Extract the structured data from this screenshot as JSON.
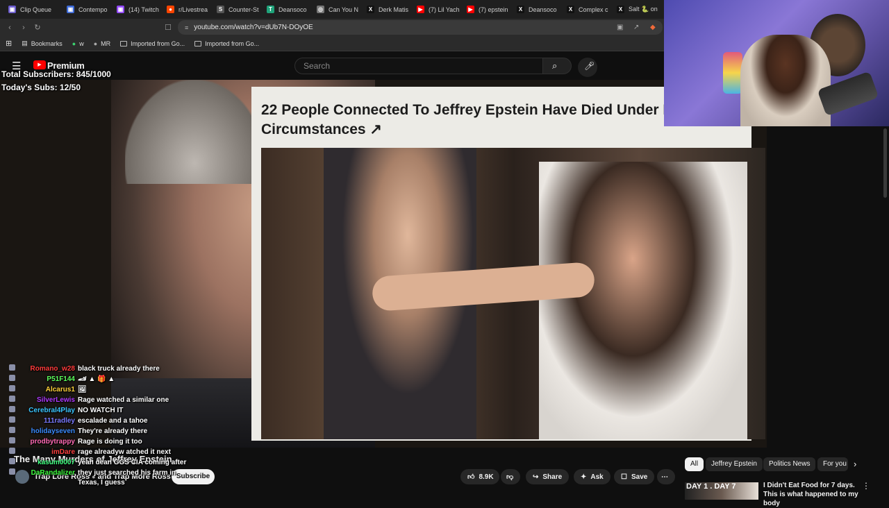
{
  "browser": {
    "tabs": [
      {
        "label": "Clip Queue",
        "color": "#6a5acd",
        "glyph": "▣"
      },
      {
        "label": "Contempo",
        "color": "#3c6ad9",
        "glyph": "▣"
      },
      {
        "label": "(14) Twitch",
        "color": "#9146ff",
        "glyph": "▣"
      },
      {
        "label": "r/Livestrea",
        "color": "#ff4500",
        "glyph": "●"
      },
      {
        "label": "Counter-St",
        "color": "#555555",
        "glyph": "S"
      },
      {
        "label": "Deansoco",
        "color": "#1fa37a",
        "glyph": "T"
      },
      {
        "label": "Can You N",
        "color": "#777777",
        "glyph": "◎"
      },
      {
        "label": "Derk Matis",
        "color": "#111111",
        "glyph": "X"
      },
      {
        "label": "(7) Lil Yach",
        "color": "#ff0000",
        "glyph": "▶"
      },
      {
        "label": "(7) epstein",
        "color": "#ff0000",
        "glyph": "▶"
      },
      {
        "label": "Deansoco",
        "color": "#111111",
        "glyph": "X"
      },
      {
        "label": "Complex c",
        "color": "#111111",
        "glyph": "X"
      },
      {
        "label": "Salt 🐍 on",
        "color": "#111111",
        "glyph": "X"
      },
      {
        "label": "",
        "color": "#ff0000",
        "glyph": "▶"
      }
    ],
    "url": "youtube.com/watch?v=dUb7N-DOyOE",
    "bookmarks": [
      {
        "label": "Bookmarks",
        "type": "bookmarks"
      },
      {
        "label": "w",
        "type": "site"
      },
      {
        "label": "MR",
        "type": "site"
      },
      {
        "label": "Imported from Go...",
        "type": "folder"
      },
      {
        "label": "Imported from Go...",
        "type": "folder"
      }
    ]
  },
  "youtube": {
    "logo_text": "Premium",
    "search_placeholder": "Search",
    "article_title": "22 People Connected To Jeffrey Epstein Have Died Under Mysterious Circumstances",
    "article_link_icon": "↗",
    "video_title": "The Many Murders of Jeffrey Epstein",
    "channel": "Trap Lore Ross",
    "channel_suffix": "and Trap More Ross",
    "subscribe_label": "Subscribe",
    "likes": "8.9K",
    "share_label": "Share",
    "ask_label": "Ask",
    "save_label": "Save",
    "more_label": "⋯",
    "chips": [
      "All",
      "Jeffrey Epstein",
      "Politics News",
      "For you"
    ],
    "recommendation": {
      "thumb_text": "DAY 1 . DAY 7",
      "title": "I Didn't Eat Food for 7 days. This is what happened to my body"
    }
  },
  "overlay": {
    "total_subs": "Total Subscribers: 845/1000",
    "todays_subs": "Today's Subs: 12/50"
  },
  "chat": [
    {
      "user": "Romano_w28",
      "color": "#ff3b3b",
      "msg": "black truck already there"
    },
    {
      "user": "P51F144",
      "color": "#5dff5d",
      "msg": "🏎 ▲ 🎁 ▲"
    },
    {
      "user": "Alcarus1",
      "color": "#ffd23b",
      "msg": "🖼"
    },
    {
      "user": "SilverLewis",
      "color": "#b03bff",
      "msg": "Rage watched a similar one"
    },
    {
      "user": "Cerebral4Play",
      "color": "#3bc6ff",
      "msg": "NO WATCH IT"
    },
    {
      "user": "111radley",
      "color": "#7a7aff",
      "msg": "escalade and a tahoe"
    },
    {
      "user": "holidayseven",
      "color": "#3b8cff",
      "msg": "They're already there"
    },
    {
      "user": "prodbytrappy",
      "color": "#ff6ab4",
      "msg": "Rage is doing it too"
    },
    {
      "user": "imDare",
      "color": "#ff4040",
      "msg": "rage alreadyw atched it next"
    },
    {
      "user": "kasum0007",
      "color": "#40ff80",
      "msg": "yeah dean GGS CIA coming after"
    },
    {
      "user": "DaRandalizer",
      "color": "#40ff40",
      "msg": "they just searched his farm in"
    },
    {
      "user": "",
      "color": "#ffffff",
      "msg": "Texas, I guess"
    }
  ]
}
